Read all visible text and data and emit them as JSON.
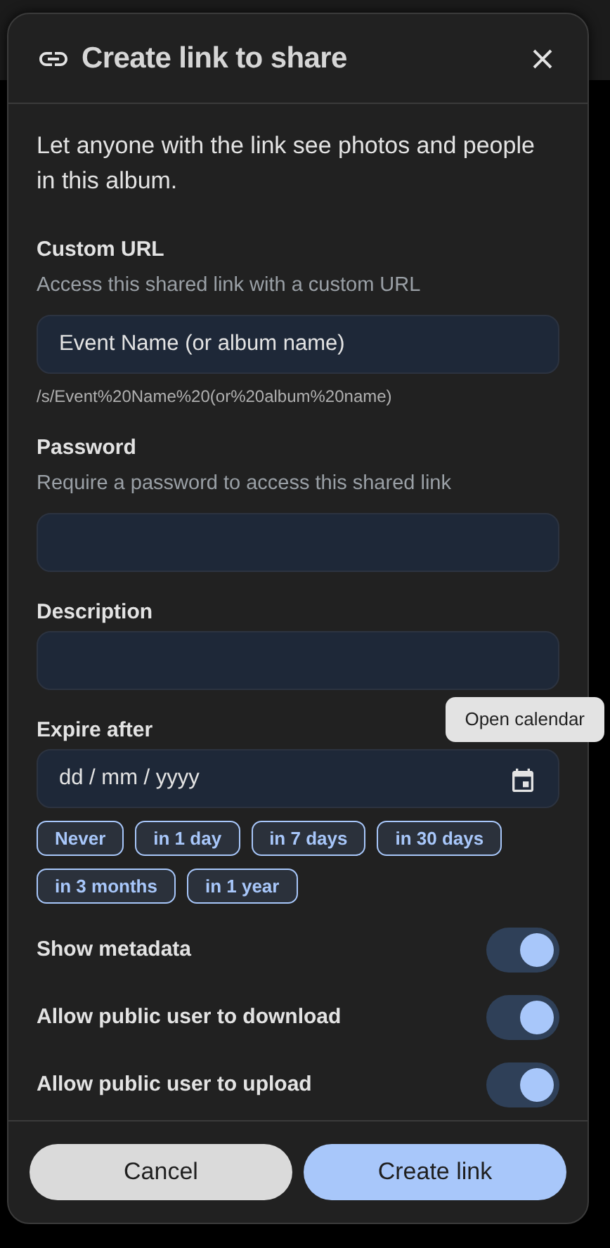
{
  "dialog": {
    "title": "Create link to share",
    "intro": "Let anyone with the link see photos and people in this album.",
    "fields": [
      {
        "kind": "text",
        "label": "Custom URL",
        "hint": "Access this shared link with a custom URL",
        "value": "Event Name (or album name)",
        "note": "/s/Event%20Name%20(or%20album%20name)"
      },
      {
        "kind": "text",
        "label": "Password",
        "hint": "Require a password to access this shared link"
      },
      {
        "kind": "text",
        "label": "Description"
      },
      {
        "kind": "date",
        "label": "Expire after",
        "placeholder": "dd / mm / yyyy",
        "tooltip": "Open calendar",
        "presets": [
          "Never",
          "in 1 day",
          "in 7 days",
          "in 30 days",
          "in 3 months",
          "in 1 year"
        ]
      }
    ],
    "toggles": [
      {
        "label": "Show metadata",
        "on": true
      },
      {
        "label": "Allow public user to download",
        "on": true
      },
      {
        "label": "Allow public user to upload",
        "on": true
      }
    ],
    "buttons": [
      {
        "label": "Cancel",
        "kind": "secondary"
      },
      {
        "label": "Create link",
        "kind": "primary"
      }
    ]
  }
}
